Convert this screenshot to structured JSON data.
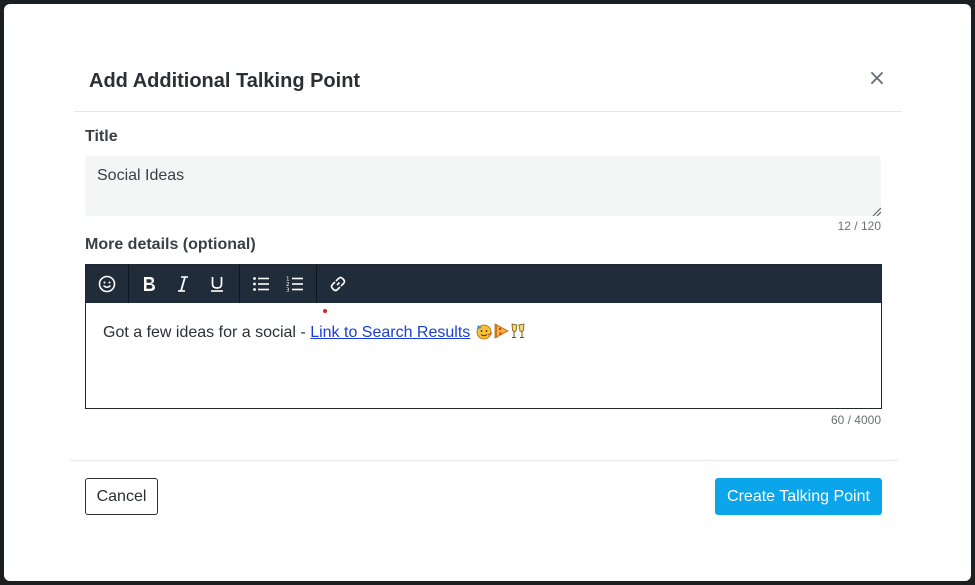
{
  "modal": {
    "title": "Add Additional Talking Point",
    "close_label": "×"
  },
  "title_field": {
    "label": "Title",
    "value": "Social Ideas",
    "counter": "12 / 120"
  },
  "details_field": {
    "label": "More details (optional)",
    "text_before_link": "Got a few ideas for a social - ",
    "link_text": "Link to Search Results",
    "emojis": [
      "partying-face-emoji",
      "pizza-emoji",
      "clinking-glasses-emoji"
    ],
    "counter": "60 / 4000"
  },
  "toolbar": {
    "buttons": [
      "emoji-icon",
      "bold-icon",
      "italic-icon",
      "underline-icon",
      "bullet-list-icon",
      "numbered-list-icon",
      "link-icon"
    ],
    "background": "#212c3a"
  },
  "footer": {
    "cancel_label": "Cancel",
    "create_label": "Create Talking Point"
  },
  "colors": {
    "primary": "#0aa5ea",
    "link": "#1a3ed6"
  }
}
